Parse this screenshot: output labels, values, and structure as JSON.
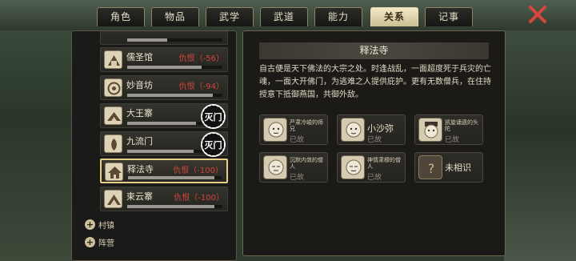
{
  "tabs": [
    {
      "label": "角色",
      "active": false
    },
    {
      "label": "物品",
      "active": false
    },
    {
      "label": "武学",
      "active": false
    },
    {
      "label": "武道",
      "active": false
    },
    {
      "label": "能力",
      "active": false
    },
    {
      "label": "关系",
      "active": true
    },
    {
      "label": "记事",
      "active": false
    }
  ],
  "colors": {
    "accent": "#e7cf8a",
    "hostile": "#d2463c",
    "close": "#d8453a"
  },
  "factions": [
    {
      "name": "",
      "status": "",
      "bar": 0.42,
      "icon": "faction-emblem-icon"
    },
    {
      "name": "儒圣馆",
      "status": "仇恨（-56）",
      "bar": 0.78,
      "icon": "faction-emblem-icon"
    },
    {
      "name": "妙音坊",
      "status": "仇恨（-94）",
      "bar": 0.9,
      "icon": "faction-emblem-icon"
    },
    {
      "name": "大王寨",
      "status": "",
      "bar": 0.72,
      "icon": "faction-emblem-icon",
      "seal": "灭门"
    },
    {
      "name": "九流门",
      "status": "",
      "bar": 0.7,
      "icon": "faction-emblem-icon",
      "seal": "灭门"
    },
    {
      "name": "释法寺",
      "status": "仇恨（-100）",
      "bar": 0.92,
      "icon": "temple-emblem-icon",
      "selected": true
    },
    {
      "name": "束云寨",
      "status": "仇恨（-100）",
      "bar": 0.92,
      "icon": "faction-emblem-icon"
    }
  ],
  "categories": [
    {
      "label": "村镇"
    },
    {
      "label": "阵营"
    }
  ],
  "detail": {
    "title": "释法寺",
    "description": "自古便是天下佛法的大宗之处。时逢战乱，一面超度死于兵灾的亡魂，一面大开佛门，为逃难之人提供庇护。更有无数僧兵，在住持授意下抵御燕国，共御外敌。",
    "members": [
      {
        "name": "严肃冷峻的师兄",
        "state": "已故"
      },
      {
        "name": "小沙弥",
        "state": "已故"
      },
      {
        "name": "凯旋诵遗的头陀",
        "state": "已故"
      },
      {
        "name": "沉默内敛的僧人",
        "state": "已故"
      },
      {
        "name": "神情肃穆的僧人",
        "state": "已故"
      },
      {
        "name": "未相识",
        "state": ""
      }
    ]
  }
}
